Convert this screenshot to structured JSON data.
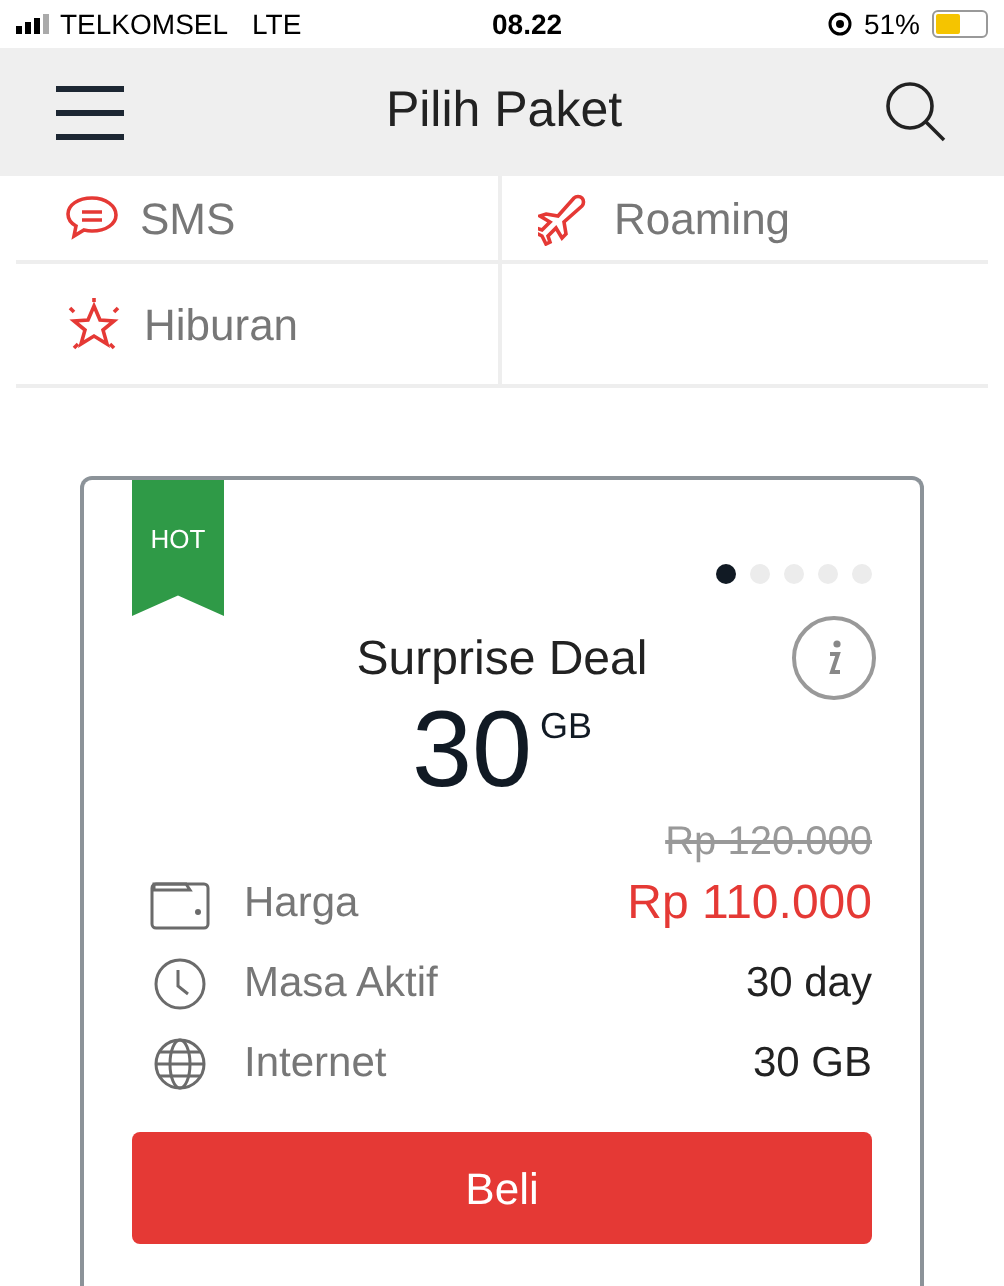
{
  "status_bar": {
    "carrier": "TELKOMSEL",
    "network": "LTE",
    "time": "08.22",
    "battery": "51%"
  },
  "header": {
    "title": "Pilih Paket"
  },
  "categories": [
    {
      "label": "SMS",
      "kind": "sms"
    },
    {
      "label": "Roaming",
      "kind": "roaming"
    },
    {
      "label": "Hiburan",
      "kind": "entertainment"
    }
  ],
  "package": {
    "badge": "HOT",
    "pages": [
      {
        "selected": true
      },
      {
        "selected": false
      },
      {
        "selected": false
      },
      {
        "selected": false
      },
      {
        "selected": false
      }
    ],
    "name": "Surprise Deal",
    "amount": "30",
    "unit": "GB",
    "old_price": "Rp 120.000",
    "details": [
      {
        "kind": "price",
        "label": "Harga",
        "value": "Rp 110.000"
      },
      {
        "kind": "period",
        "label": "Masa Aktif",
        "value": "30 day"
      },
      {
        "kind": "data",
        "label": "Internet",
        "value": "30 GB"
      }
    ],
    "button": "Beli"
  }
}
